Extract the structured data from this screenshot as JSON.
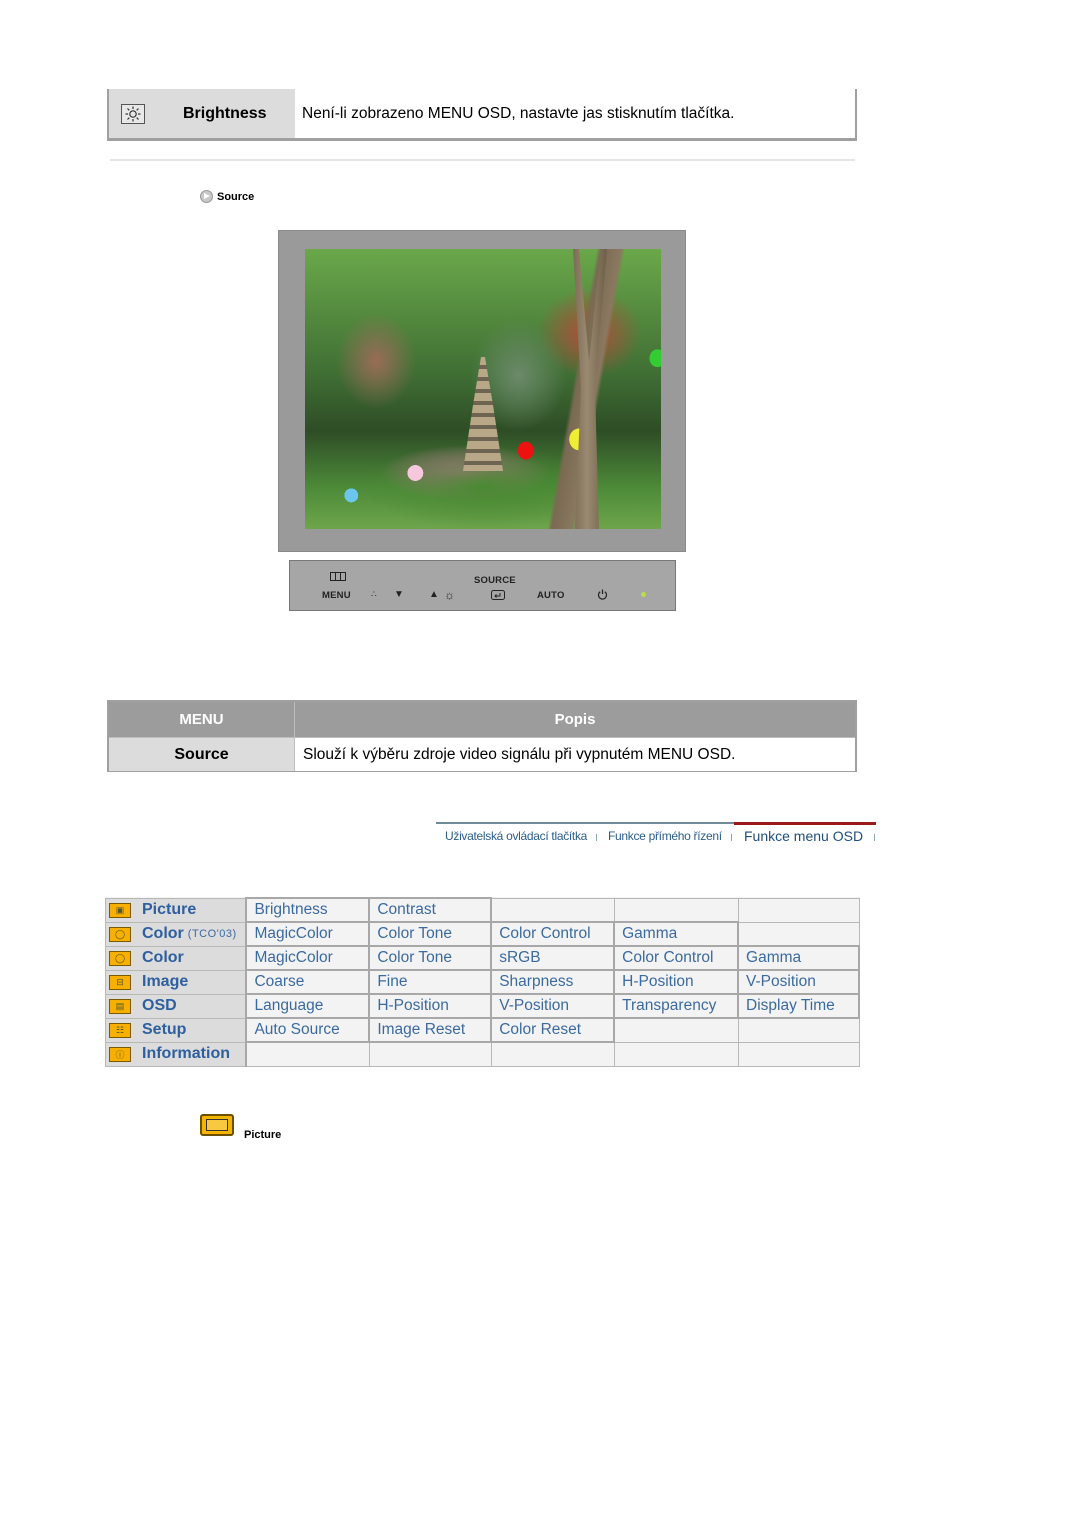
{
  "brightness_row": {
    "icon": "sun-icon",
    "label": "Brightness",
    "description": "Není-li zobrazeno MENU OSD, nastavte jas stisknutím tlačítka."
  },
  "source_link": {
    "icon": "arrow-circle-icon",
    "label": "Source"
  },
  "monitor_image": {
    "alt": "Monitor displaying garden with pagoda and lanterns"
  },
  "button_panel": {
    "menu_label": "MENU",
    "source_label": "SOURCE",
    "auto_label": "AUTO",
    "icons": [
      "menu-icon",
      "magicbright-icon",
      "down-triangle-icon",
      "up-triangle-icon",
      "brightness-icon",
      "enter-icon",
      "power-icon",
      "power-led-icon"
    ]
  },
  "menu_table": {
    "header_menu": "MENU",
    "header_desc": "Popis",
    "rows": [
      {
        "menu": "Source",
        "desc": "Slouží k výběru zdroje video signálu při vypnutém MENU OSD."
      }
    ]
  },
  "nav_tabs": {
    "items": [
      {
        "label": "Uživatelská ovládací tlačítka",
        "active": false
      },
      {
        "label": "Funkce přímého řízení",
        "active": false
      },
      {
        "label": "Funkce menu OSD",
        "active": true
      }
    ],
    "accent_color": "#9a1a1a"
  },
  "osd_menu": {
    "rows": [
      {
        "category": "Picture",
        "sub": "",
        "icon": "picture-icon",
        "items": [
          "Brightness",
          "Contrast",
          "",
          "",
          ""
        ]
      },
      {
        "category": "Color",
        "sub": "(TCO'03)",
        "icon": "color-icon",
        "items": [
          "MagicColor",
          "Color Tone",
          "Color Control",
          "Gamma",
          ""
        ]
      },
      {
        "category": "Color",
        "sub": "",
        "icon": "color-icon",
        "items": [
          "MagicColor",
          "Color Tone",
          "sRGB",
          "Color Control",
          "Gamma"
        ]
      },
      {
        "category": "Image",
        "sub": "",
        "icon": "image-icon",
        "items": [
          "Coarse",
          "Fine",
          "Sharpness",
          "H-Position",
          "V-Position"
        ]
      },
      {
        "category": "OSD",
        "sub": "",
        "icon": "osd-icon",
        "items": [
          "Language",
          "H-Position",
          "V-Position",
          "Transparency",
          "Display Time"
        ]
      },
      {
        "category": "Setup",
        "sub": "",
        "icon": "setup-icon",
        "items": [
          "Auto Source",
          "Image Reset",
          "Color Reset",
          "",
          ""
        ]
      },
      {
        "category": "Information",
        "sub": "",
        "icon": "information-icon",
        "items": [
          "",
          "",
          "",
          "",
          ""
        ]
      }
    ],
    "link_color": "#3b6aa0"
  },
  "picture_link": {
    "icon": "picture-icon",
    "label": "Picture"
  }
}
